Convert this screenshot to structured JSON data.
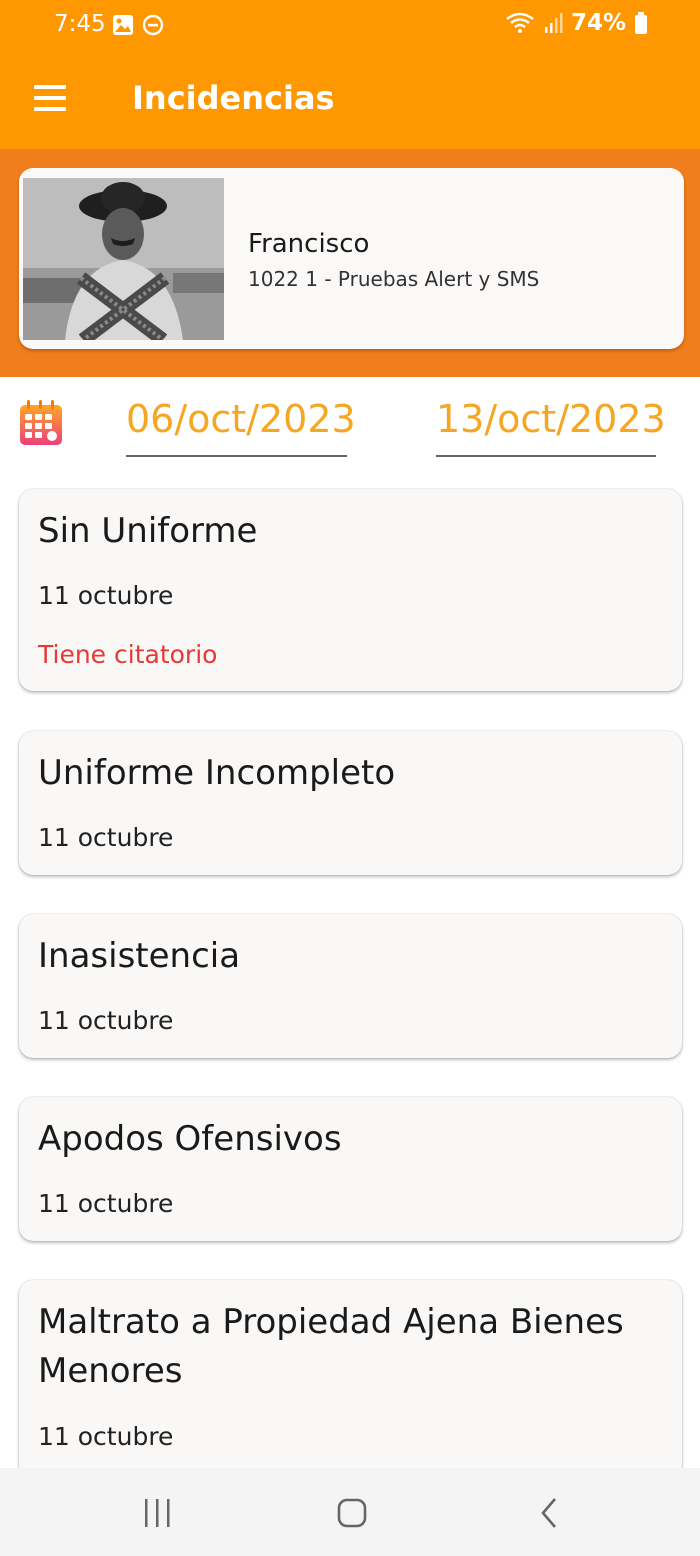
{
  "status_bar": {
    "time": "7:45",
    "battery": "74%"
  },
  "app_bar": {
    "title": "Incidencias",
    "menu_icon": "hamburger-menu-icon"
  },
  "profile": {
    "name": "Francisco",
    "subtitle": "1022 1 - Pruebas Alert y SMS"
  },
  "date_range": {
    "from": "06/oct/2023",
    "to": "13/oct/2023"
  },
  "incidents": [
    {
      "title": "Sin Uniforme",
      "date": "11 octubre",
      "note": "Tiene citatorio"
    },
    {
      "title": "Uniforme Incompleto",
      "date": "11 octubre"
    },
    {
      "title": "Inasistencia",
      "date": "11 octubre"
    },
    {
      "title": "Apodos Ofensivos",
      "date": "11 octubre"
    },
    {
      "title": "Maltrato a Propiedad Ajena Bienes Menores",
      "date": "11 octubre"
    }
  ],
  "colors": {
    "primary": "#FF9800",
    "primary_dark": "#F07E1D",
    "date_text": "#F5A623",
    "alert_text": "#E53935"
  }
}
